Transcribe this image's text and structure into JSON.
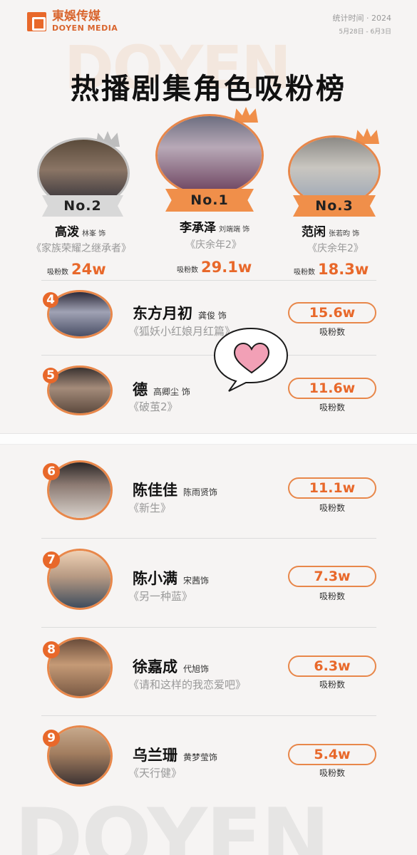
{
  "brand": {
    "name_cn": "東娛传媒",
    "name_en": "DOYEN MEDIA"
  },
  "stat": {
    "label": "统计时间 · 2024",
    "range": "5月28日 - 6月3日"
  },
  "watermark": {
    "top": "DOYEN",
    "bottom": "DOYEN"
  },
  "title": "热播剧集角色吸粉榜",
  "fans_label": "吸粉数",
  "top3": [
    {
      "rank_label": "No.2",
      "role": "高泼",
      "actor": "林峯 饰",
      "show": "《家族荣耀之继承者》",
      "fans": "24w"
    },
    {
      "rank_label": "No.1",
      "role": "李承泽",
      "actor": "刘端端 饰",
      "show": "《庆余年2》",
      "fans": "29.1w"
    },
    {
      "rank_label": "No.3",
      "role": "范闲",
      "actor": "张若昀 饰",
      "show": "《庆余年2》",
      "fans": "18.3w"
    }
  ],
  "rows": [
    {
      "rank": "4",
      "role": "东方月初",
      "actor": "龚俊 饰",
      "show": "《狐妖小红娘月红篇》",
      "fans": "15.6w"
    },
    {
      "rank": "5",
      "role": "德",
      "actor": "高卿尘 饰",
      "show": "《破茧2》",
      "fans": "11.6w"
    },
    {
      "rank": "6",
      "role": "陈佳佳",
      "actor": "陈雨贤饰",
      "show": "《新生》",
      "fans": "11.1w"
    },
    {
      "rank": "7",
      "role": "陈小满",
      "actor": "宋茜饰",
      "show": "《另一种蓝》",
      "fans": "7.3w"
    },
    {
      "rank": "8",
      "role": "徐嘉成",
      "actor": "代旭饰",
      "show": "《请和这样的我恋爱吧》",
      "fans": "6.3w"
    },
    {
      "rank": "9",
      "role": "乌兰珊",
      "actor": "黄梦莹饰",
      "show": "《天行健》",
      "fans": "5.4w"
    }
  ],
  "colors": {
    "accent": "#e8682a",
    "ring": "#e8874a",
    "silver": "#c2c2c2"
  }
}
